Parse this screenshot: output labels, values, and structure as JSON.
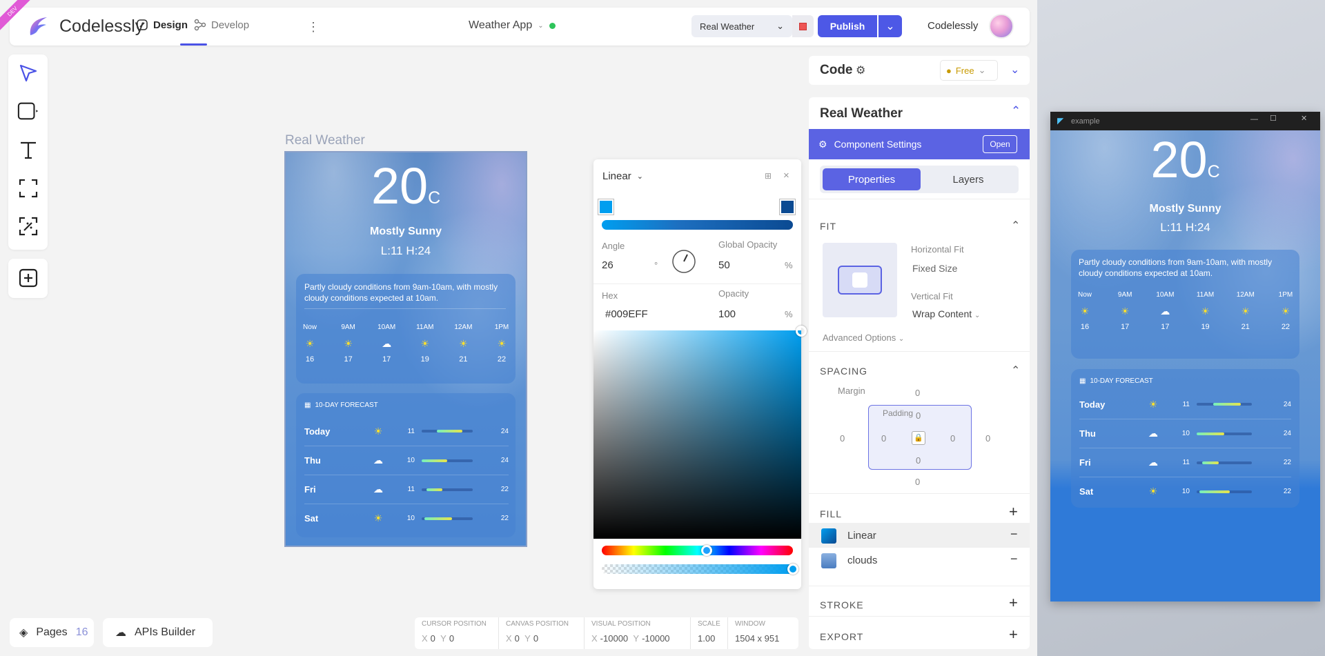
{
  "app": {
    "brand": "Codelessly",
    "ribbon": "DEV",
    "tabs": {
      "design": "Design",
      "develop": "Develop"
    },
    "project": "Weather App",
    "component_select": "Real Weather",
    "publish": "Publish",
    "user": "Codelessly"
  },
  "bottom": {
    "pages_label": "Pages",
    "pages_count": "16",
    "apis": "APIs Builder",
    "status": {
      "cursor_label": "CURSOR POSITION",
      "cursor_x": "0",
      "cursor_y": "0",
      "canvas_label": "CANVAS POSITION",
      "canvas_x": "0",
      "canvas_y": "0",
      "visual_label": "VISUAL POSITION",
      "visual_x": "-10000",
      "visual_y": "-10000",
      "scale_label": "SCALE",
      "scale": "1.00",
      "window_label": "WINDOW",
      "window": "1504 x 951"
    }
  },
  "canvas": {
    "frame_title": "Real Weather"
  },
  "weather": {
    "temp": "20",
    "unit": "C",
    "condition": "Mostly Sunny",
    "hilo": "L:11 H:24",
    "description": "Partly cloudy conditions from 9am-10am, with mostly cloudy conditions expected at 10am.",
    "hours": [
      {
        "t": "Now",
        "icon": "sun",
        "v": "16"
      },
      {
        "t": "9AM",
        "icon": "sun",
        "v": "17"
      },
      {
        "t": "10AM",
        "icon": "cloud",
        "v": "17"
      },
      {
        "t": "11AM",
        "icon": "sun",
        "v": "19"
      },
      {
        "t": "12AM",
        "icon": "sun",
        "v": "21"
      },
      {
        "t": "1PM",
        "icon": "sun",
        "v": "22"
      }
    ],
    "forecast_title": "10-DAY FORECAST",
    "days": [
      {
        "d": "Today",
        "icon": "sun",
        "lo": "11",
        "hi": "24",
        "from": 0.3,
        "to": 0.8
      },
      {
        "d": "Thu",
        "icon": "cloud",
        "lo": "10",
        "hi": "24",
        "from": 0.0,
        "to": 0.5
      },
      {
        "d": "Fri",
        "icon": "cloud",
        "lo": "11",
        "hi": "22",
        "from": 0.1,
        "to": 0.4
      },
      {
        "d": "Sat",
        "icon": "sun",
        "lo": "10",
        "hi": "22",
        "from": 0.05,
        "to": 0.6
      }
    ]
  },
  "picker": {
    "type": "Linear",
    "angle_label": "Angle",
    "angle": "26",
    "deg": "°",
    "gopacity_label": "Global Opacity",
    "gopacity": "50",
    "pct": "%",
    "hex_label": "Hex",
    "hex": "#009EFF",
    "opacity_label": "Opacity",
    "opacity": "100",
    "stop1_color": "#009eef",
    "stop2_color": "#0b4a92",
    "hue_position": 0.55
  },
  "panel": {
    "code_title": "Code",
    "free": "Free",
    "section_title": "Real Weather",
    "component_settings": "Component Settings",
    "open": "Open",
    "tab_properties": "Properties",
    "tab_layers": "Layers",
    "fit_title": "FIT",
    "hfit_label": "Horizontal Fit",
    "hfit": "Fixed Size",
    "vfit_label": "Vertical Fit",
    "vfit": "Wrap Content",
    "advanced": "Advanced Options",
    "spacing_title": "SPACING",
    "margin_label": "Margin",
    "padding_label": "Padding",
    "zero": "0",
    "fill_title": "FILL",
    "fill_items": [
      "Linear",
      "clouds"
    ],
    "stroke_title": "STROKE",
    "export_title": "EXPORT"
  },
  "window": {
    "title": "example"
  }
}
